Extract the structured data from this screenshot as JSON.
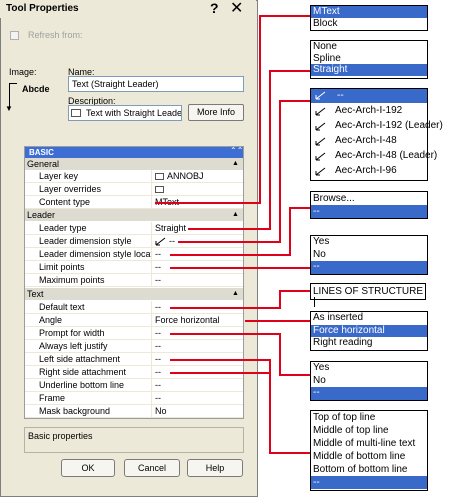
{
  "dialog": {
    "title": "Tool Properties",
    "help_glyph": "?",
    "close_glyph": "✕",
    "refresh_label": "Refresh from:",
    "image_label": "Image:",
    "image_text": "Abcde",
    "name_label": "Name:",
    "name_value": "Text (Straight Leader)",
    "description_label": "Description:",
    "description_value": "Text with Straight Leader",
    "more_info": "More Info"
  },
  "grid": {
    "section_title": "BASIC",
    "categories": {
      "general": "General",
      "leader": "Leader",
      "text": "Text"
    },
    "general": [
      {
        "name": "Layer key",
        "value": "ANNOBJ"
      },
      {
        "name": "Layer overrides",
        "value": ""
      },
      {
        "name": "Content type",
        "value": "MText"
      }
    ],
    "leader": [
      {
        "name": "Leader type",
        "value": "Straight"
      },
      {
        "name": "Leader dimension style",
        "value": "--"
      },
      {
        "name": "Leader dimension style locat...",
        "value": "--"
      },
      {
        "name": "Limit points",
        "value": "--"
      },
      {
        "name": "Maximum points",
        "value": "--"
      }
    ],
    "text": [
      {
        "name": "Default text",
        "value": "--"
      },
      {
        "name": "Angle",
        "value": "Force horizontal"
      },
      {
        "name": "Prompt for width",
        "value": "--"
      },
      {
        "name": "Always left justify",
        "value": "--"
      },
      {
        "name": "Left side attachment",
        "value": "--"
      },
      {
        "name": "Right side attachment",
        "value": "--"
      },
      {
        "name": "Underline bottom line",
        "value": "--"
      },
      {
        "name": "Frame",
        "value": "--"
      },
      {
        "name": "Mask background",
        "value": "No"
      }
    ],
    "description": "Basic properties"
  },
  "buttons": {
    "ok": "OK",
    "cancel": "Cancel",
    "help": "Help"
  },
  "callouts": {
    "content_type": [
      "MText",
      "Block"
    ],
    "leader_type": [
      "None",
      "Spline",
      "Straight"
    ],
    "dim_style": [
      "--",
      "Aec-Arch-I-192",
      "Aec-Arch-I-192 (Leader)",
      "Aec-Arch-I-48",
      "Aec-Arch-I-48 (Leader)",
      "Aec-Arch-I-96"
    ],
    "dim_location": [
      "Browse...",
      "--"
    ],
    "limit_points": [
      "Yes",
      "No",
      "--"
    ],
    "default_text": "LINES OF STRUCTURE",
    "angle": [
      "As inserted",
      "Force horizontal",
      "Right reading"
    ],
    "prompt_width": [
      "Yes",
      "No",
      "--"
    ],
    "attachment": [
      "Top of top line",
      "Middle of top line",
      "Middle of multi-line text",
      "Middle of bottom line",
      "Bottom of bottom line",
      "--"
    ]
  },
  "colors": {
    "accent": "#3969c9",
    "callout_line": "#e1001a",
    "dialog_bg": "#ece9d8"
  }
}
